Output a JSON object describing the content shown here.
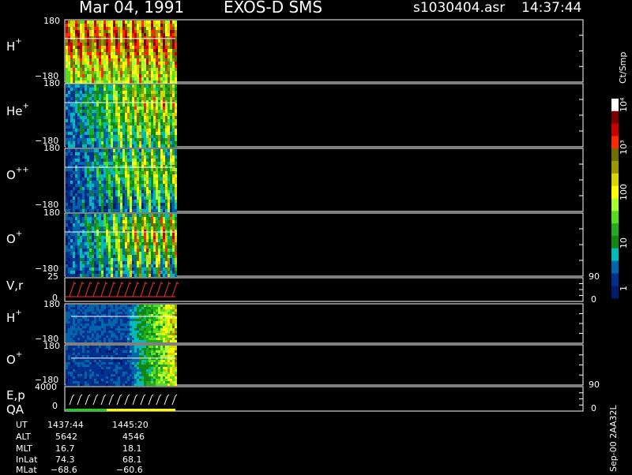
{
  "header": {
    "date": "Mar 04, 1991",
    "instrument": "EXOS-D SMS",
    "filename": "s1030404.asr",
    "time": "14:37:44"
  },
  "colorbar": {
    "unit": "Ct/Smp",
    "tick_labels": [
      "10⁴",
      "10³",
      "100",
      "10",
      "1"
    ],
    "colors": [
      "#ffffff",
      "#7a0000",
      "#c80000",
      "#ff2a00",
      "#6e6e00",
      "#9a9a00",
      "#d6d600",
      "#ffff00",
      "#aaff33",
      "#55dd22",
      "#22aa22",
      "#118811",
      "#00bbbb",
      "#0066aa",
      "#00308f",
      "#001a6e"
    ]
  },
  "panels": [
    {
      "id": "h-plus-pa",
      "label": "H",
      "sup": "+",
      "ymax": "180",
      "ymin": "−180"
    },
    {
      "id": "he-plus-pa",
      "label": "He",
      "sup": "+",
      "ymax": "180",
      "ymin": "−180"
    },
    {
      "id": "o-plusplus-pa",
      "label": "O",
      "sup": "++",
      "ymax": "180",
      "ymin": "−180"
    },
    {
      "id": "o-plus-pa",
      "label": "O",
      "sup": "+",
      "ymax": "180",
      "ymin": "−180"
    },
    {
      "id": "v-r",
      "label": "V,r",
      "sup": "",
      "ymax": "25",
      "ymin": "0",
      "rmax": "90",
      "rmin": "0"
    },
    {
      "id": "h-plus-2",
      "label": "H",
      "sup": "+",
      "ymax": "180",
      "ymin": "−180"
    },
    {
      "id": "o-plus-2",
      "label": "O",
      "sup": "+",
      "ymax": "180",
      "ymin": "−180"
    },
    {
      "id": "e-p",
      "label": "E,p",
      "label2": "QA",
      "sup": "",
      "ymax": "4000",
      "ymin": "0",
      "rmax": "90",
      "rmin": "0"
    }
  ],
  "ephemeris": {
    "rows": [
      {
        "name": "UT",
        "v1": "1437:44",
        "v2": "1445:20"
      },
      {
        "name": "ALT",
        "v1": "5642",
        "v2": "4546"
      },
      {
        "name": "MLT",
        "v1": "16.7",
        "v2": "18.1"
      },
      {
        "name": "InLat",
        "v1": "74.3",
        "v2": "68.1"
      },
      {
        "name": "MLat",
        "v1": "−68.6",
        "v2": "−60.6"
      }
    ]
  },
  "footer_version": "Sep-00 2AA32L",
  "chart_data": {
    "type": "heatmap",
    "title": "Mar 04, 1991   EXOS-D SMS",
    "xlabel": "UT",
    "x_range": [
      "1437:44",
      "1445:20"
    ],
    "ylabel": "",
    "series": [
      {
        "name": "H+",
        "y_range": [
          -180,
          180
        ]
      },
      {
        "name": "He+",
        "y_range": [
          -180,
          180
        ]
      },
      {
        "name": "O++",
        "y_range": [
          -180,
          180
        ]
      },
      {
        "name": "O+",
        "y_range": [
          -180,
          180
        ]
      },
      {
        "name": "V,r",
        "y_range": [
          0,
          25
        ]
      },
      {
        "name": "H+",
        "y_range": [
          -180,
          180
        ]
      },
      {
        "name": "O+",
        "y_range": [
          -180,
          180
        ]
      },
      {
        "name": "E,p",
        "y_range": [
          0,
          4000
        ]
      }
    ],
    "color_scale": {
      "unit": "Ct/Smp",
      "min": 1,
      "max": 10000,
      "scale": "log"
    },
    "data_coverage_fraction": 0.2
  }
}
